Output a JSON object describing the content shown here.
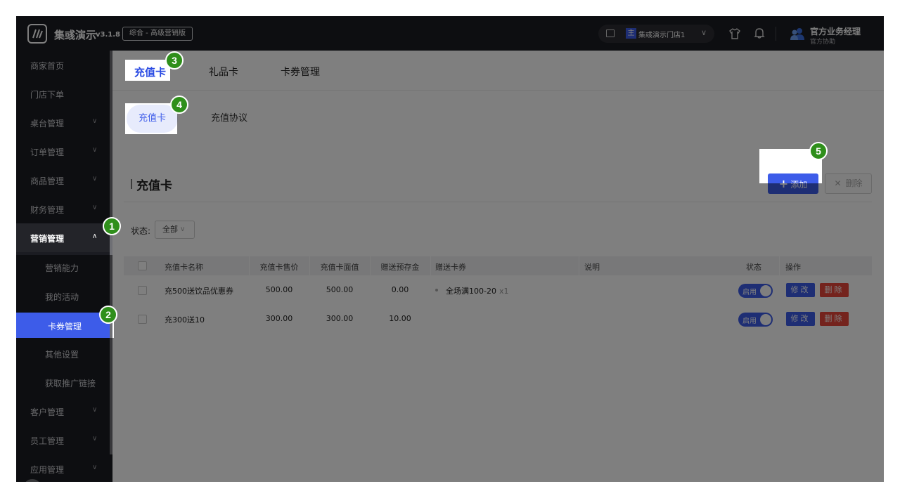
{
  "topbar": {
    "brand": "集彧演示",
    "version": "v3.1.8",
    "edition": "综合 - 高级营销版",
    "store_tag": "主",
    "store_name": "集彧演示门店1",
    "user_name": "官方业务经理",
    "user_sub": "官方协助"
  },
  "sidebar": {
    "items": [
      {
        "label": "商家首页"
      },
      {
        "label": "门店下单"
      },
      {
        "label": "桌台管理"
      },
      {
        "label": "订单管理"
      },
      {
        "label": "商品管理"
      },
      {
        "label": "财务管理"
      },
      {
        "label": "营销管理"
      },
      {
        "label": "营销能力"
      },
      {
        "label": "我的活动"
      },
      {
        "label": "卡券管理"
      },
      {
        "label": "其他设置"
      },
      {
        "label": "获取推广链接"
      },
      {
        "label": "客户管理"
      },
      {
        "label": "员工管理"
      },
      {
        "label": "应用管理"
      }
    ]
  },
  "tabs": [
    "充值卡",
    "礼品卡",
    "卡券管理"
  ],
  "subtabs": [
    "充值卡",
    "充值协议"
  ],
  "section": {
    "title": "充值卡",
    "add_label": "添加",
    "delete_label": "删除",
    "filter_label": "状态:",
    "filter_value": "全部"
  },
  "table": {
    "headers": [
      "充值卡名称",
      "充值卡售价",
      "充值卡面值",
      "赠送预存金",
      "赠送卡券",
      "说明",
      "状态",
      "操作"
    ],
    "rows": [
      {
        "name": "充500送饮品优惠券",
        "price": "500.00",
        "face": "500.00",
        "bonus": "0.00",
        "coupon": "全场满100-20",
        "coupon_qty": "x1",
        "status": "启用",
        "edit": "修改",
        "del": "删除"
      },
      {
        "name": "充300送10",
        "price": "300.00",
        "face": "300.00",
        "bonus": "10.00",
        "coupon": "",
        "coupon_qty": "",
        "status": "启用",
        "edit": "修改",
        "del": "删除"
      }
    ]
  },
  "badges": [
    "1",
    "2",
    "3",
    "4",
    "5"
  ],
  "colors": {
    "accent": "#3d5ce9",
    "danger": "#e8473a",
    "dark": "#1b1c22",
    "badge": "#2f8f1b"
  }
}
